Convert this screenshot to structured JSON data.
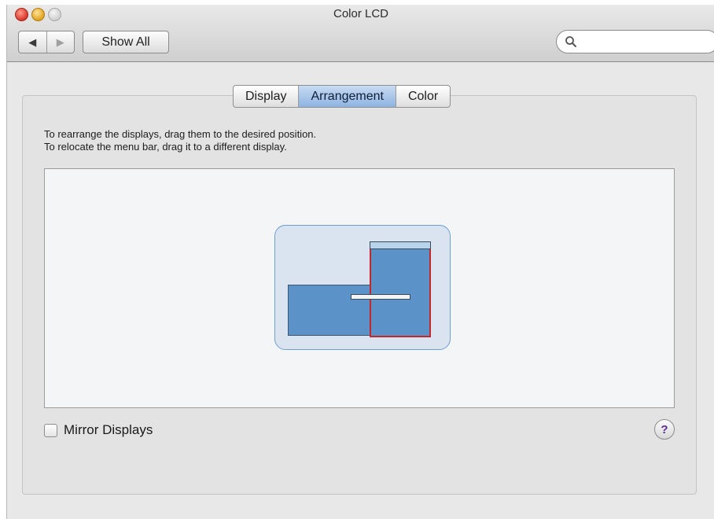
{
  "window": {
    "title": "Color LCD"
  },
  "toolbar": {
    "back_glyph": "◀",
    "forward_glyph": "▶",
    "show_all_label": "Show All",
    "search_placeholder": ""
  },
  "tabs": [
    {
      "label": "Display",
      "active": false
    },
    {
      "label": "Arrangement",
      "active": true
    },
    {
      "label": "Color",
      "active": false
    }
  ],
  "arrangement": {
    "instruction_line1": "To rearrange the displays, drag them to the desired position.",
    "instruction_line2": "To relocate the menu bar, drag it to a different display."
  },
  "mirror": {
    "label": "Mirror Displays",
    "checked": false
  },
  "help": {
    "glyph": "?"
  },
  "colors": {
    "display_fill": "#5b93c9",
    "selected_display_border": "#c4282a",
    "group_background": "#d9e4f0",
    "active_tab": "#8fb3e0"
  },
  "icons": [
    "close-icon",
    "minimize-icon",
    "zoom-icon",
    "back-arrow-icon",
    "forward-arrow-icon",
    "search-icon",
    "help-icon"
  ]
}
